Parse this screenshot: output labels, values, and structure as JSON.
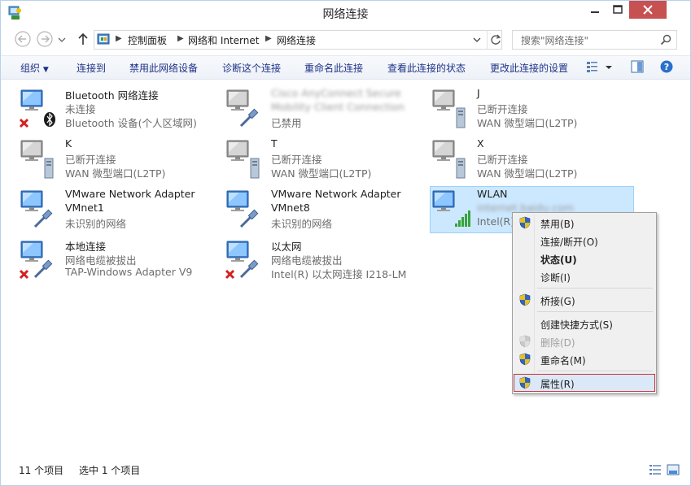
{
  "window": {
    "title": "网络连接"
  },
  "address": {
    "crumbs": [
      "控制面板",
      "网络和 Internet",
      "网络连接"
    ],
    "search_placeholder": "搜索\"网络连接\""
  },
  "toolbar": {
    "organize": "组织",
    "connect_to": "连接到",
    "disable_device": "禁用此网络设备",
    "diagnose": "诊断这个连接",
    "rename": "重命名此连接",
    "view_status": "查看此连接的状态",
    "change_settings": "更改此连接的设置"
  },
  "connections": [
    {
      "name": "Bluetooth 网络连接",
      "status": "未连接",
      "device": "Bluetooth 设备(个人区域网)"
    },
    {
      "name": "Cisco AnyConnect Secure",
      "status": "Mobility Client Connection",
      "device": "已禁用"
    },
    {
      "name": "J",
      "status": "已断开连接",
      "device": "WAN 微型端口(L2TP)"
    },
    {
      "name": "K",
      "status": "已断开连接",
      "device": "WAN 微型端口(L2TP)"
    },
    {
      "name": "T",
      "status": "已断开连接",
      "device": "WAN 微型端口(L2TP)"
    },
    {
      "name": "X",
      "status": "已断开连接",
      "device": "WAN 微型端口(L2TP)"
    },
    {
      "name": "VMware Network Adapter",
      "status": "VMnet1",
      "device": "未识别的网络"
    },
    {
      "name": "VMware Network Adapter",
      "status": "VMnet8",
      "device": "未识别的网络"
    },
    {
      "name": "WLAN",
      "status": "internet.baidu.com",
      "device": "Intel(R)"
    },
    {
      "name": "本地连接",
      "status": "网络电缆被拔出",
      "device": "TAP-Windows Adapter V9"
    },
    {
      "name": "以太网",
      "status": "网络电缆被拔出",
      "device": "Intel(R) 以太网连接 I218-LM"
    }
  ],
  "context_menu": {
    "disable": "禁用(B)",
    "connect": "连接/断开(O)",
    "status": "状态(U)",
    "diagnose": "诊断(I)",
    "bridge": "桥接(G)",
    "shortcut": "创建快捷方式(S)",
    "delete": "删除(D)",
    "rename": "重命名(M)",
    "properties": "属性(R)"
  },
  "statusbar": {
    "count": "11 个项目",
    "selected": "选中 1 个项目"
  },
  "colors": {
    "link": "#1e3287",
    "selection": "#cce8ff",
    "highlight_border": "#c4323a",
    "close": "#c75050"
  }
}
